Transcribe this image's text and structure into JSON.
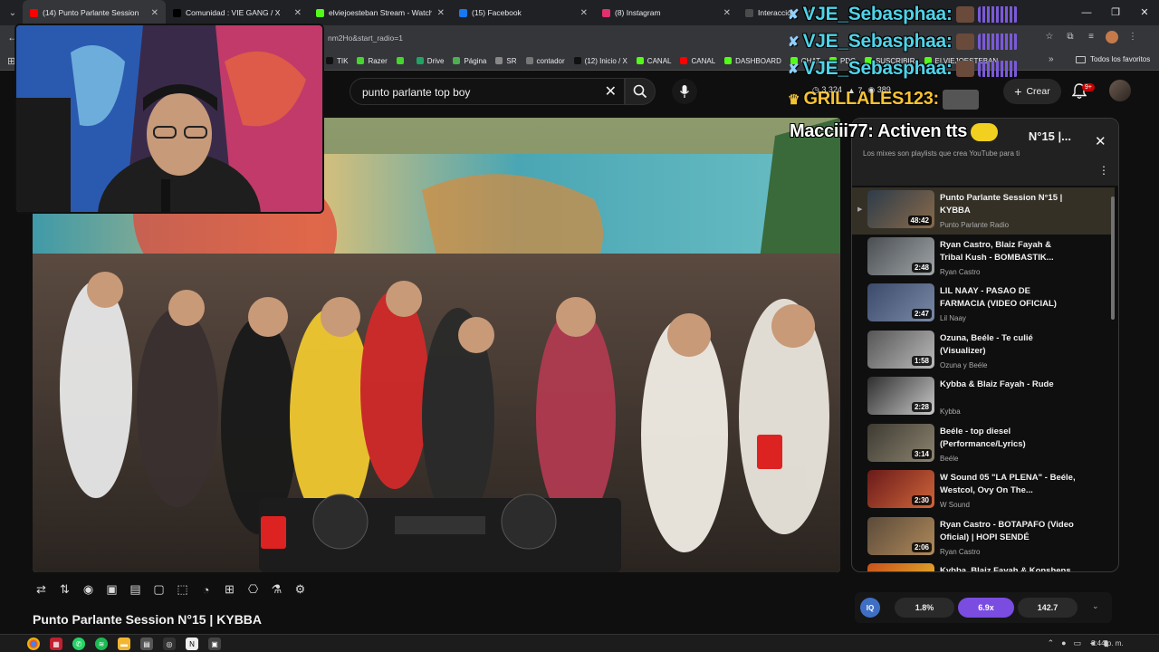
{
  "browser": {
    "tabs": [
      {
        "title": "(14) Punto Parlante Session",
        "color": "#ff0000",
        "active": true
      },
      {
        "title": "Comunidad : VIE GANG / X",
        "color": "#000000",
        "active": false
      },
      {
        "title": "elviejoesteban Stream - Watch",
        "color": "#53fc18",
        "active": false
      },
      {
        "title": "(15) Facebook",
        "color": "#1877f2",
        "active": false
      },
      {
        "title": "(8) Instagram",
        "color": "#e1306c",
        "active": false
      },
      {
        "title": "Interacción",
        "color": "#4b4b4b",
        "active": false
      }
    ],
    "url": "nm2Ho&start_radio=1",
    "bookmarks": [
      {
        "label": "TIK",
        "color": "#111111",
        "glyph": "♪"
      },
      {
        "label": "Razer",
        "color": "#44d62c",
        "glyph": "R"
      },
      {
        "label": "",
        "color": "#44d62c",
        "glyph": "R"
      },
      {
        "label": "Drive",
        "color": "#1fa463",
        "glyph": "▲"
      },
      {
        "label": "Página",
        "color": "#4caf50",
        "glyph": "P"
      },
      {
        "label": "SR",
        "color": "#888888",
        "glyph": "◆"
      },
      {
        "label": "contador",
        "color": "#777777",
        "glyph": "◆"
      },
      {
        "label": "(12) Inicio / X",
        "color": "#111111",
        "glyph": "X"
      },
      {
        "label": "CANAL",
        "color": "#53fc18",
        "glyph": "K"
      },
      {
        "label": "CANAL",
        "color": "#ff0000",
        "glyph": "▶"
      },
      {
        "label": "DASHBOARD",
        "color": "#53fc18",
        "glyph": "K"
      },
      {
        "label": "CHAT",
        "color": "#53fc18",
        "glyph": "K"
      },
      {
        "label": "PDC",
        "color": "#53fc18",
        "glyph": "K"
      },
      {
        "label": "SUSCRIBIR",
        "color": "#53fc18",
        "glyph": "K"
      },
      {
        "label": "ELVIEJOESTEBAN",
        "color": "#53fc18",
        "glyph": "K"
      }
    ],
    "all_favorites": "Todos los favoritos"
  },
  "youtube": {
    "search_query": "punto parlante top boy",
    "create_label": "Crear",
    "notification_count": "9+",
    "video_title": "Punto Parlante Session N°15 | KYBBA",
    "mix": {
      "title": "N°15 |...",
      "subtitle": "Los mixes son playlists que crea YouTube para ti",
      "items": [
        {
          "title": "Punto Parlante Session N°15 | KYBBA",
          "channel": "Punto Parlante Radio",
          "duration": "48:42",
          "thumb": [
            "#2d3c4a",
            "#8a6a4a"
          ],
          "active": true
        },
        {
          "title": "Ryan Castro, Blaiz Fayah & Tribal Kush - BOMBASTIK...",
          "channel": "Ryan Castro",
          "duration": "2:48",
          "thumb": [
            "#4a4e52",
            "#a0a5a8"
          ],
          "active": false
        },
        {
          "title": "LIL NAAY - PASAO DE FARMACIA (VIDEO OFICIAL)",
          "channel": "Lil Naay",
          "duration": "2:47",
          "thumb": [
            "#3b4a6a",
            "#7a8aa6"
          ],
          "active": false
        },
        {
          "title": "Ozuna, Beéle - Te culié (Visualizer)",
          "channel": "Ozuna y Beéle",
          "duration": "1:58",
          "thumb": [
            "#555555",
            "#bbbbbb"
          ],
          "active": false
        },
        {
          "title": "Kybba & Blaiz Fayah - Rude",
          "channel": "Kybba",
          "duration": "2:28",
          "thumb": [
            "#2e2e2e",
            "#c9c9c9"
          ],
          "active": false
        },
        {
          "title": "Beéle - top diesel (Performance/Lyrics)",
          "channel": "Beéle",
          "duration": "3:14",
          "thumb": [
            "#3e3a32",
            "#8c8470"
          ],
          "active": false
        },
        {
          "title": "W Sound 05 \"LA PLENA\" - Beéle, Westcol, Ovy On The...",
          "channel": "W Sound",
          "duration": "2:30",
          "thumb": [
            "#6a1a1a",
            "#d0663a"
          ],
          "active": false
        },
        {
          "title": "Ryan Castro - BOTAPAFO (Video Oficial) | HOPI SENDÉ",
          "channel": "Ryan Castro",
          "duration": "2:06",
          "thumb": [
            "#5a4a3a",
            "#b08a5a"
          ],
          "active": false
        },
        {
          "title": "Kybba, Blaiz Fayah & Konshens",
          "channel": "",
          "duration": "",
          "thumb": [
            "#c8501a",
            "#e8c030"
          ],
          "active": false
        }
      ]
    }
  },
  "overlay": {
    "chat": [
      {
        "name": "VJE_Sebasphaa:",
        "style": "cyan"
      },
      {
        "name": "VJE_Sebasphaa:",
        "style": "cyan"
      },
      {
        "name": "VJE_Sebasphaa:",
        "style": "cyan"
      },
      {
        "name": "GRILLALES123:",
        "style": "gold"
      },
      {
        "name": "Macciii77: Activen tts",
        "style": "white"
      }
    ],
    "stats": [
      "3,324",
      "7",
      "389"
    ]
  },
  "widget": {
    "badge": "IQ",
    "values": [
      "1.8%",
      "6.9x",
      "142.7"
    ]
  },
  "taskbar": {
    "time": "8:44 p. m."
  }
}
